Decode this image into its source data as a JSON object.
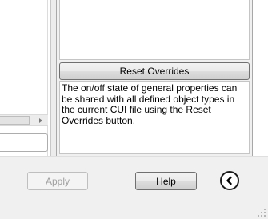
{
  "property_panel": {
    "reset_overrides_label": "Reset Overrides",
    "help_text": "The on/off state of general properties can be shared with all defined object types in the current CUI file using the Reset Overrides button."
  },
  "dialog_buttons": {
    "apply_label": "Apply",
    "help_label": "Help",
    "collapse_icon": "chevron-left-icon"
  }
}
